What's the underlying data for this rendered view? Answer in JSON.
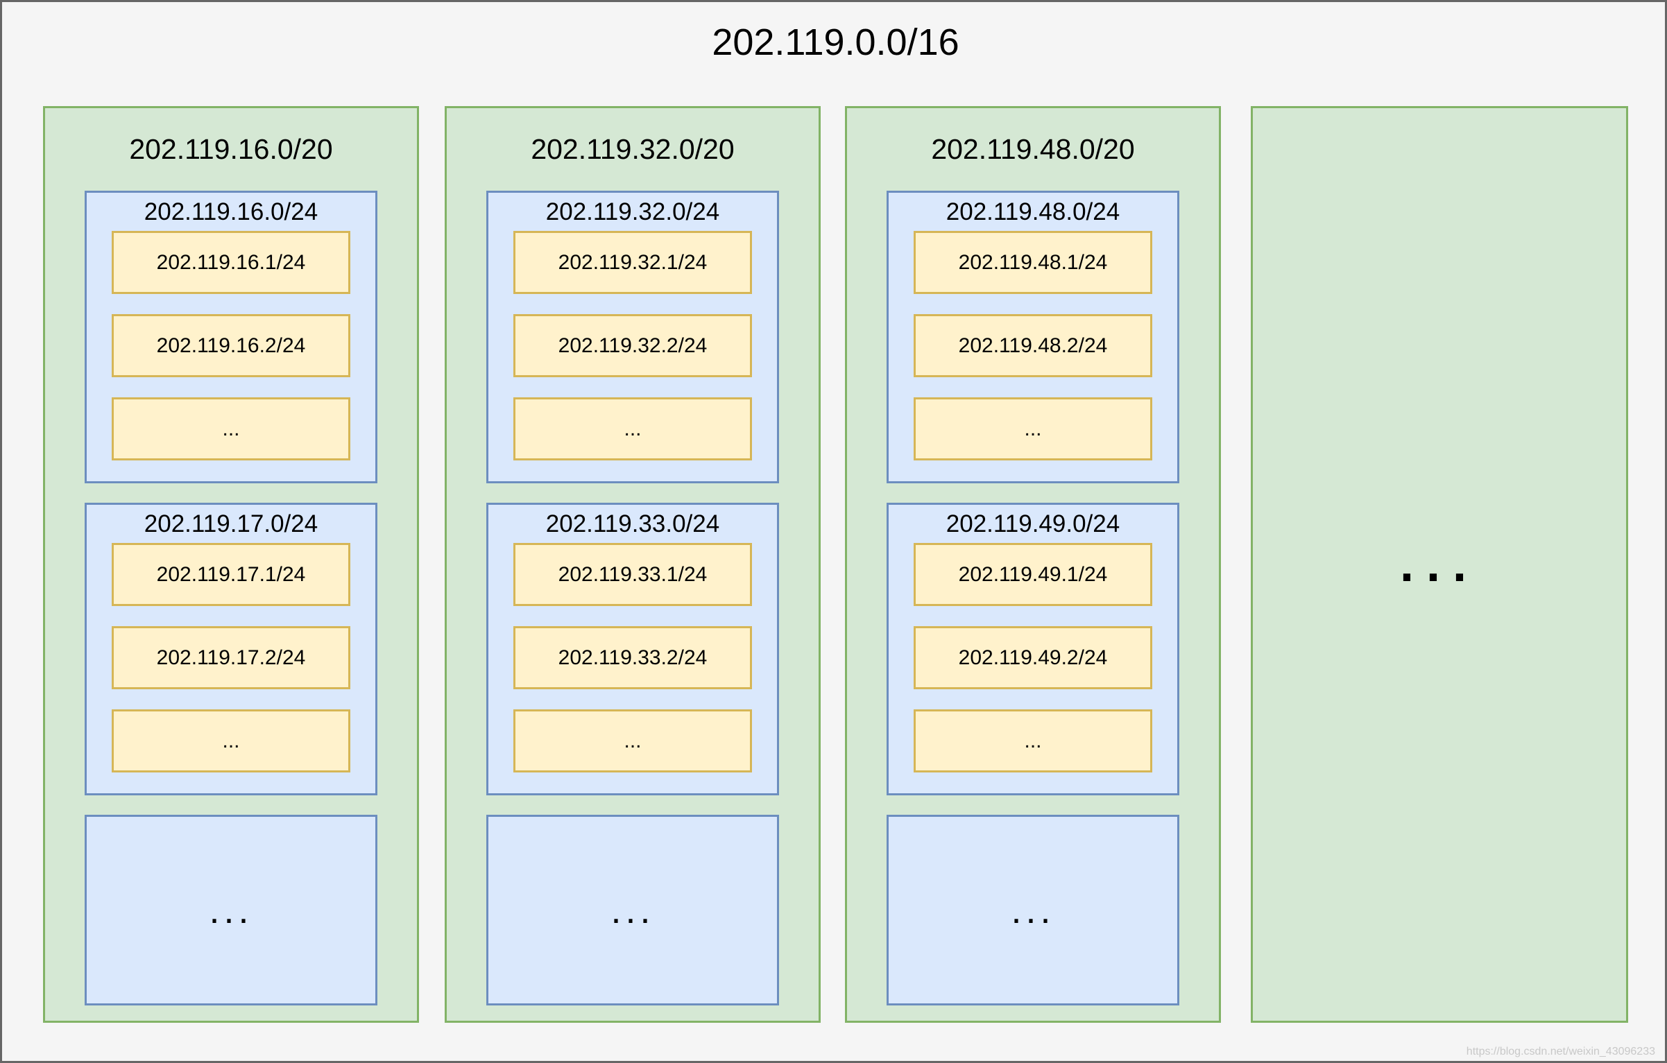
{
  "network": {
    "title": "202.119.0.0/16",
    "columns": [
      {
        "title": "202.119.16.0/20",
        "subnets": [
          {
            "title": "202.119.16.0/24",
            "hosts": [
              "202.119.16.1/24",
              "202.119.16.2/24",
              "..."
            ]
          },
          {
            "title": "202.119.17.0/24",
            "hosts": [
              "202.119.17.1/24",
              "202.119.17.2/24",
              "..."
            ]
          }
        ],
        "more_subnets": "..."
      },
      {
        "title": "202.119.32.0/20",
        "subnets": [
          {
            "title": "202.119.32.0/24",
            "hosts": [
              "202.119.32.1/24",
              "202.119.32.2/24",
              "..."
            ]
          },
          {
            "title": "202.119.33.0/24",
            "hosts": [
              "202.119.33.1/24",
              "202.119.33.2/24",
              "..."
            ]
          }
        ],
        "more_subnets": "..."
      },
      {
        "title": "202.119.48.0/20",
        "subnets": [
          {
            "title": "202.119.48.0/24",
            "hosts": [
              "202.119.48.1/24",
              "202.119.48.2/24",
              "..."
            ]
          },
          {
            "title": "202.119.49.0/24",
            "hosts": [
              "202.119.49.1/24",
              "202.119.49.2/24",
              "..."
            ]
          }
        ],
        "more_subnets": "..."
      }
    ],
    "more_columns": "..."
  },
  "watermark": "https://blog.csdn.net/weixin_43096233"
}
